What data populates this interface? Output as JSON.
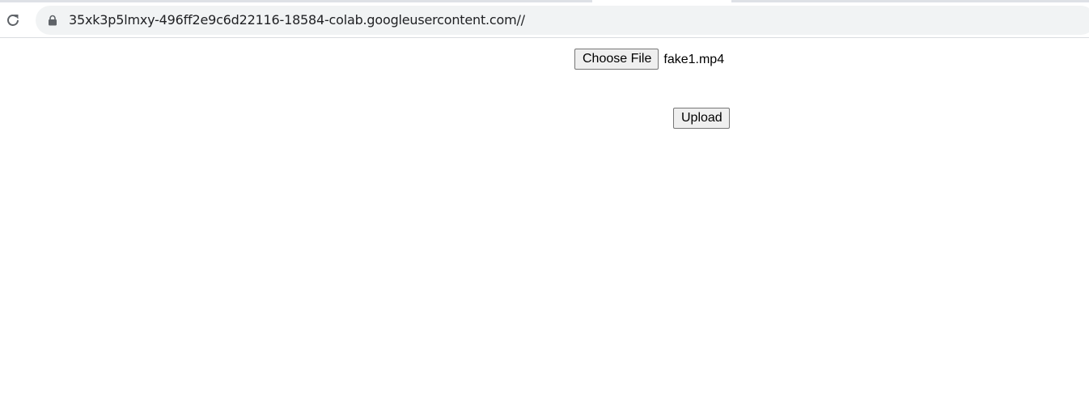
{
  "browser": {
    "url": "35xk3p5lmxy-496ff2e9c6d22116-18584-colab.googleusercontent.com//",
    "reload_icon": "reload-icon",
    "lock_icon": "lock-icon"
  },
  "form": {
    "choose_file_label": "Choose File",
    "file_name": "fake1.mp4",
    "upload_label": "Upload"
  }
}
